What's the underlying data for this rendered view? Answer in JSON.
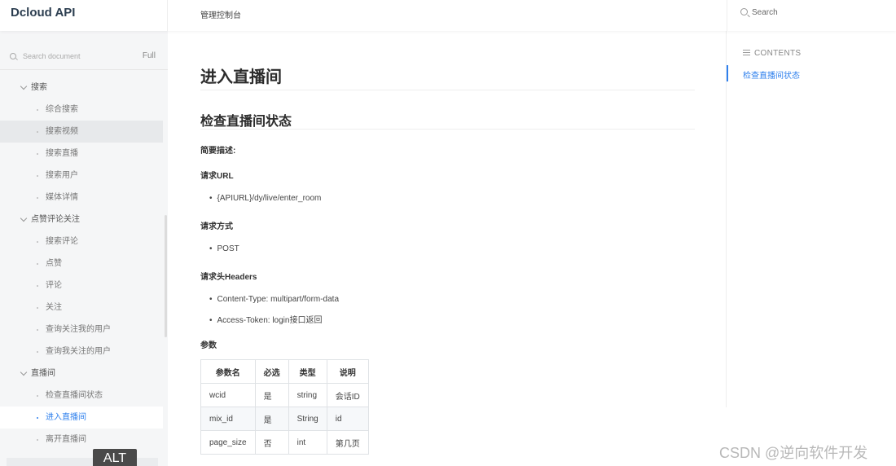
{
  "header": {
    "brand": "Dcloud API",
    "breadcrumb": "管理控制台",
    "search_placeholder": "Search"
  },
  "sidebar": {
    "search_placeholder": "Search document",
    "full_label": "Full",
    "items": [
      {
        "type": "group",
        "label": "搜索"
      },
      {
        "type": "leaf",
        "label": "综合搜索"
      },
      {
        "type": "leaf",
        "label": "搜索视频",
        "state": "hover"
      },
      {
        "type": "leaf",
        "label": "搜索直播"
      },
      {
        "type": "leaf",
        "label": "搜索用户"
      },
      {
        "type": "leaf",
        "label": "媒体详情"
      },
      {
        "type": "group",
        "label": "点赞评论关注"
      },
      {
        "type": "leaf",
        "label": "搜索评论"
      },
      {
        "type": "leaf",
        "label": "点赞"
      },
      {
        "type": "leaf",
        "label": "评论"
      },
      {
        "type": "leaf",
        "label": "关注"
      },
      {
        "type": "leaf",
        "label": "查询关注我的用户"
      },
      {
        "type": "leaf",
        "label": "查询我关注的用户"
      },
      {
        "type": "group",
        "label": "直播间"
      },
      {
        "type": "leaf",
        "label": "检查直播间状态"
      },
      {
        "type": "leaf",
        "label": "进入直播间",
        "state": "active"
      },
      {
        "type": "leaf",
        "label": "离开直播间"
      }
    ],
    "alt_badge": "ALT"
  },
  "main": {
    "title": "进入直播间",
    "subtitle": "检查直播间状态",
    "brief_label": "简要描述:",
    "url_label": "请求URL",
    "url_value": "{APIURL}/dy/live/enter_room",
    "method_label": "请求方式",
    "method_value": "POST",
    "headers_label": "请求头Headers",
    "headers": [
      "Content-Type: multipart/form-data",
      "Access-Token: login接口返回"
    ],
    "params_label": "参数",
    "params_table": {
      "columns": [
        "参数名",
        "必选",
        "类型",
        "说明"
      ],
      "rows": [
        [
          "wcid",
          "是",
          "string",
          "会话ID"
        ],
        [
          "mix_id",
          "是",
          "String",
          "id"
        ],
        [
          "page_size",
          "否",
          "int",
          "第几页"
        ]
      ]
    }
  },
  "toc": {
    "title": "CONTENTS",
    "items": [
      "检查直播间状态"
    ]
  },
  "watermark": "CSDN @逆向软件开发",
  "colors": {
    "accent": "#2f80ed",
    "sidebar_bg": "#f5f6f7"
  }
}
